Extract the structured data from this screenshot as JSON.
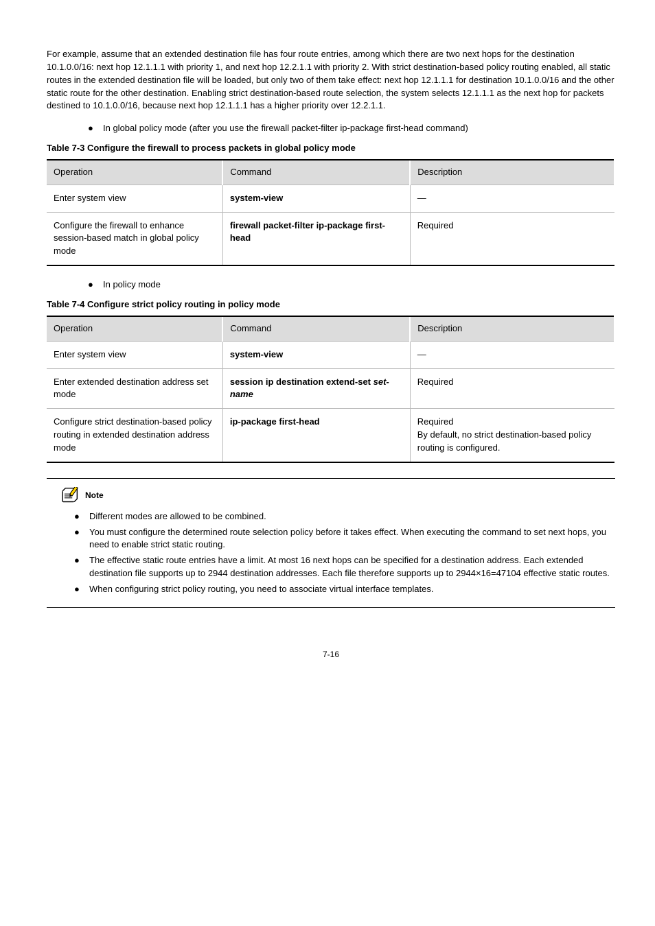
{
  "intro_para": "For example, assume that an extended destination file has four route entries, among which there are two next hops for the destination 10.1.0.0/16: next hop 12.1.1.1 with priority 1, and next hop 12.2.1.1 with priority 2. With strict destination-based policy routing enabled, all static routes in the extended destination file will be loaded, but only two of them take effect: next hop 12.1.1.1 for destination 10.1.0.0/16 and the other static route for the other destination. Enabling strict destination-based route selection, the system selects 12.1.1.1 as the next hop for packets destined to 10.1.0.0/16, because next hop 12.1.1.1 has a higher priority over 12.2.1.1.",
  "bullets": [
    "In global policy mode (after you use the firewall packet-filter ip-package first-head command)",
    "In policy mode"
  ],
  "table1": {
    "caption": "Table 7-3 Configure the firewall to process packets in global policy mode",
    "headers": [
      "Operation",
      "Command",
      "Description"
    ],
    "rows": [
      {
        "op": "Enter system view",
        "cmdParts": [
          {
            "t": "system-view",
            "k": "cmd"
          }
        ],
        "desc": "—"
      },
      {
        "op": "Configure the firewall to enhance session-based match in global policy mode",
        "cmdParts": [
          {
            "t": "firewall packet-filter ip-package first-head",
            "k": "cmd"
          }
        ],
        "desc": "Required"
      }
    ]
  },
  "table2": {
    "caption": "Table 7-4 Configure strict policy routing in policy mode",
    "headers": [
      "Operation",
      "Command",
      "Description"
    ],
    "rows": [
      {
        "op": "Enter system view",
        "cmdParts": [
          {
            "t": "system-view",
            "k": "cmd"
          }
        ],
        "desc": "—"
      },
      {
        "op": "Enter extended destination address set mode",
        "cmdParts": [
          {
            "t": "session ip destination extend-set ",
            "k": "cmd"
          },
          {
            "t": "set-name",
            "k": "arg"
          }
        ],
        "desc": "Required"
      },
      {
        "op": "Configure strict destination-based policy routing in extended destination address mode",
        "cmdParts": [
          {
            "t": "ip-package first-head",
            "k": "cmd"
          }
        ],
        "desc": "Required\nBy default, no strict destination-based policy routing is configured."
      }
    ]
  },
  "note": {
    "label": "Note",
    "items": [
      "Different modes are allowed to be combined.",
      "You must configure the determined route selection policy before it takes effect. When executing the command to set next hops, you need to enable strict static routing.",
      "The effective static route entries have a limit. At most 16 next hops can be specified for a destination address. Each extended destination file supports up to 2944 destination addresses. Each file therefore supports up to 2944×16=47104 effective static routes.",
      "When configuring strict policy routing, you need to associate virtual interface templates."
    ]
  },
  "pagenum": "7-16"
}
